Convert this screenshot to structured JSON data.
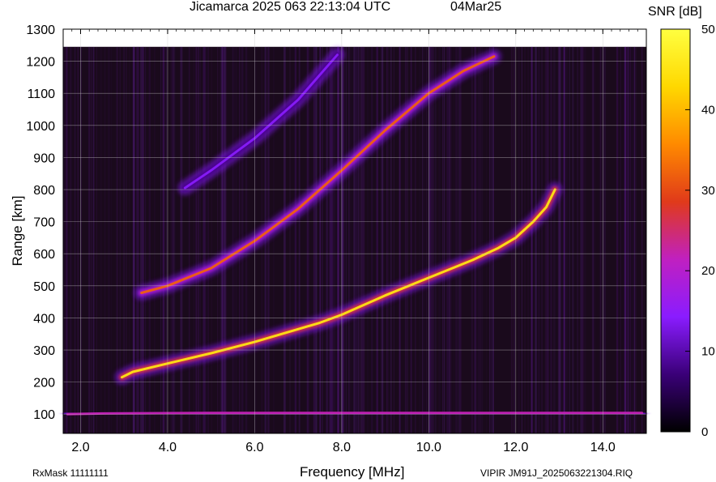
{
  "header": {
    "title": "Jicamarca 2025 063 22:13:04 UTC",
    "date": "04Mar25"
  },
  "footer": {
    "rxmask": "RxMask 11111111",
    "filename": "VIPIR  JM91J_2025063221304.RIQ"
  },
  "chart_data": {
    "type": "heatmap",
    "title": "Jicamarca 2025 063 22:13:04 UTC",
    "xlabel": "Frequency [MHz]",
    "ylabel": "Range [km]",
    "xlim": [
      1.6,
      15.0
    ],
    "ylim": [
      40,
      1300
    ],
    "x_ticks": [
      "2.0",
      "4.0",
      "6.0",
      "8.0",
      "10.0",
      "12.0",
      "14.0"
    ],
    "x_tick_values": [
      2,
      4,
      6,
      8,
      10,
      12,
      14
    ],
    "y_ticks": [
      "100",
      "200",
      "300",
      "400",
      "500",
      "600",
      "700",
      "800",
      "900",
      "1000",
      "1100",
      "1200",
      "1300"
    ],
    "y_tick_values": [
      100,
      200,
      300,
      400,
      500,
      600,
      700,
      800,
      900,
      1000,
      1100,
      1200,
      1300
    ],
    "grid": true,
    "colorbar": {
      "label": "SNR [dB]",
      "range": [
        0,
        50
      ],
      "ticks": [
        "0",
        "10",
        "20",
        "30",
        "40",
        "50"
      ],
      "tick_values": [
        0,
        10,
        20,
        30,
        40,
        50
      ],
      "colors": [
        "#000000",
        "#3a0078",
        "#8a1cff",
        "#c020c0",
        "#e03a1a",
        "#ff8a00",
        "#ffd800",
        "#ffff40"
      ]
    },
    "background_color": "#1a0a1c",
    "traces": [
      {
        "kind": "E-layer echo",
        "points": [
          [
            1.7,
            100
          ],
          [
            2.5,
            102
          ],
          [
            3.5,
            103
          ],
          [
            5.0,
            104
          ],
          [
            7.0,
            104
          ],
          [
            9.0,
            104
          ],
          [
            11.0,
            104
          ],
          [
            13.0,
            104
          ],
          [
            14.9,
            104
          ]
        ],
        "peak_snr": 22
      },
      {
        "kind": "F trace (1-hop)",
        "points": [
          [
            2.95,
            215
          ],
          [
            3.2,
            232
          ],
          [
            4.0,
            258
          ],
          [
            5.0,
            290
          ],
          [
            6.0,
            325
          ],
          [
            7.0,
            365
          ],
          [
            7.5,
            385
          ],
          [
            8.0,
            410
          ],
          [
            9.0,
            470
          ],
          [
            10.0,
            525
          ],
          [
            11.0,
            580
          ],
          [
            11.6,
            618
          ],
          [
            12.0,
            650
          ],
          [
            12.4,
            700
          ],
          [
            12.7,
            745
          ],
          [
            12.9,
            800
          ]
        ],
        "peak_snr": 45
      },
      {
        "kind": "F trace (2-hop)",
        "points": [
          [
            3.4,
            478
          ],
          [
            4.0,
            500
          ],
          [
            5.0,
            555
          ],
          [
            6.0,
            640
          ],
          [
            7.0,
            740
          ],
          [
            7.5,
            800
          ],
          [
            8.0,
            860
          ],
          [
            9.0,
            985
          ],
          [
            10.0,
            1100
          ],
          [
            10.8,
            1170
          ],
          [
            11.5,
            1215
          ]
        ],
        "peak_snr": 32
      },
      {
        "kind": "F trace (3-hop)",
        "points": [
          [
            4.4,
            805
          ],
          [
            5.0,
            860
          ],
          [
            6.0,
            960
          ],
          [
            7.0,
            1080
          ],
          [
            7.9,
            1220
          ]
        ],
        "peak_snr": 14
      }
    ]
  }
}
